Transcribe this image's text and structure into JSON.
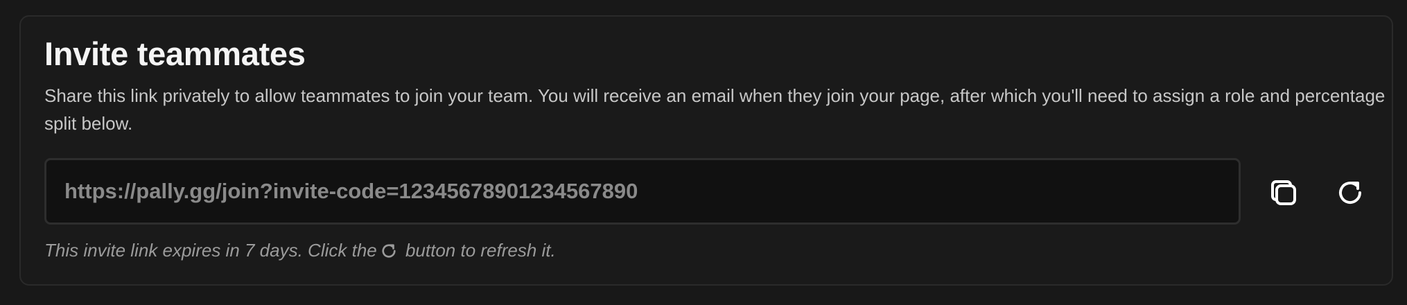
{
  "invite": {
    "title": "Invite teammates",
    "description": "Share this link privately to allow teammates to join your team. You will receive an email when they join your page, after which you'll need to assign a role and percentage split below.",
    "link_value": "https://pally.gg/join?invite-code=12345678901234567890",
    "hint_before": "This invite link expires in 7 days. Click the",
    "hint_after": " button to refresh it."
  },
  "icons": {
    "copy": "copy-icon",
    "refresh": "refresh-icon"
  },
  "colors": {
    "background": "#181818",
    "card_border": "#2a2a2a",
    "field_background": "#111111",
    "title": "#f5f5f5",
    "muted_text": "#9b9b9b"
  }
}
